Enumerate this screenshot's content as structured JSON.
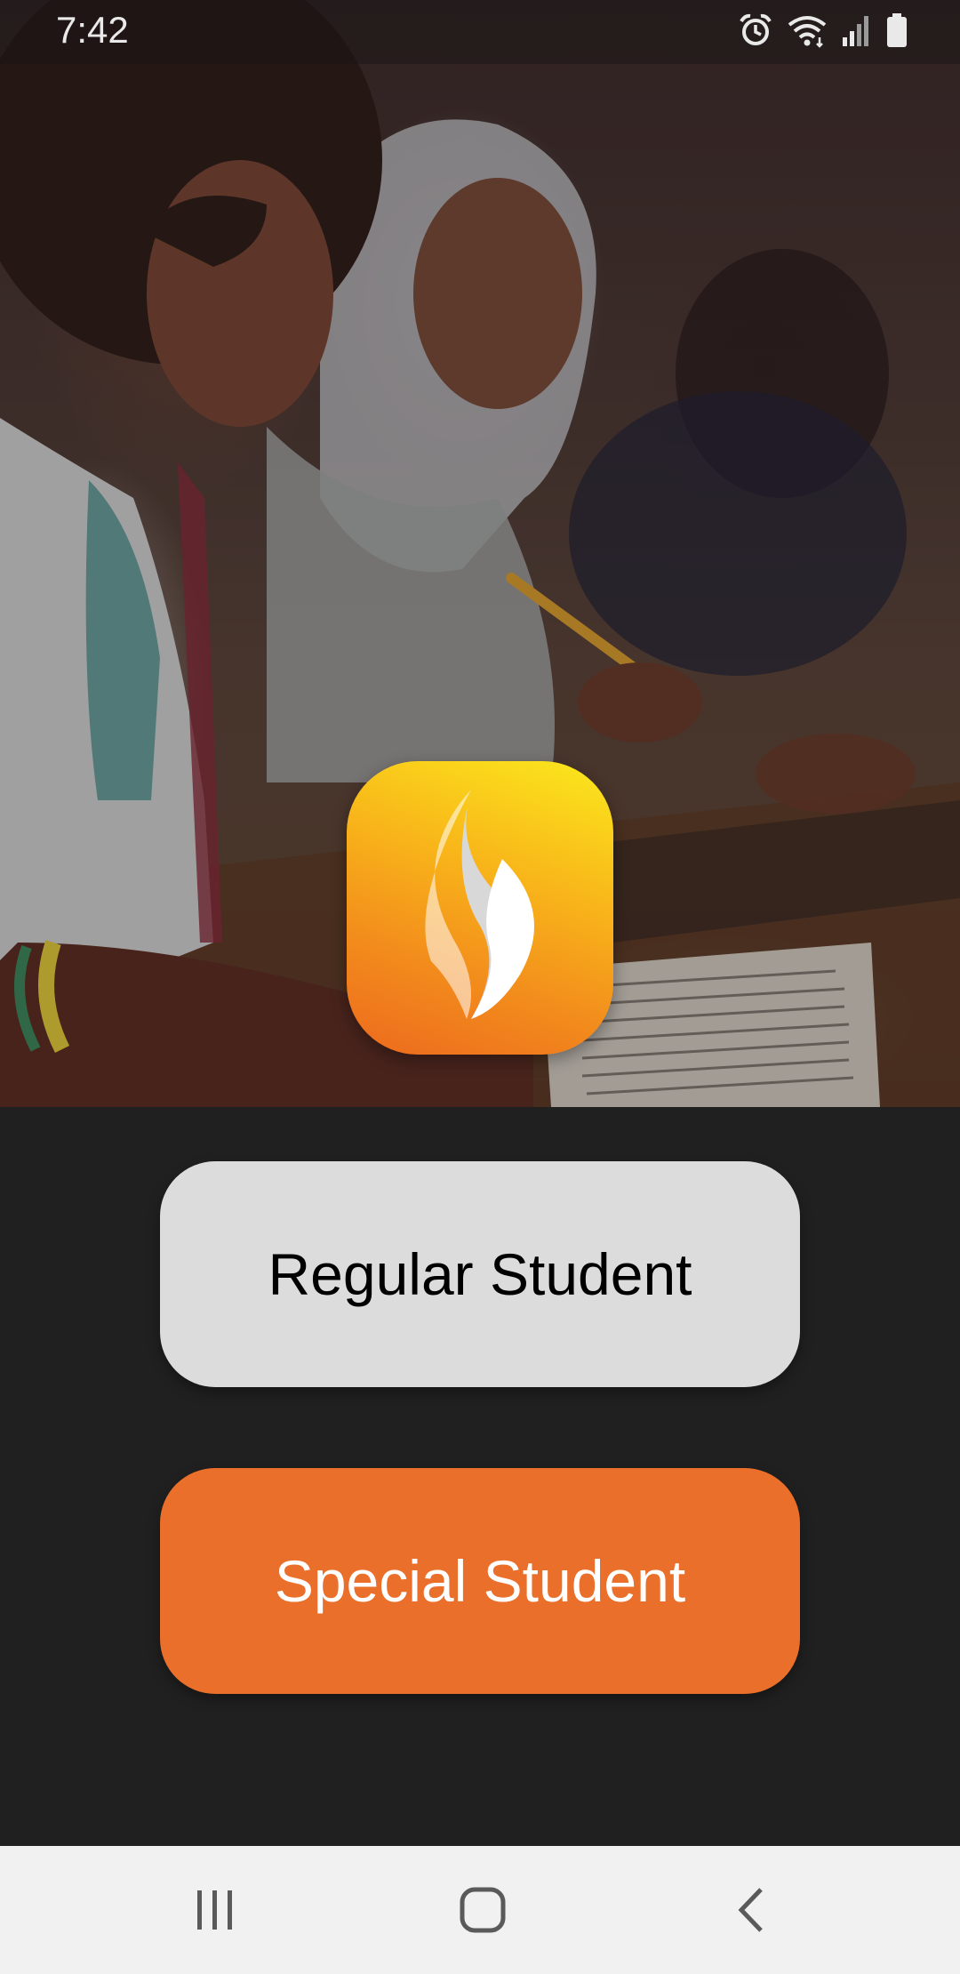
{
  "status_bar": {
    "time": "7:42",
    "icons": [
      "alarm-icon",
      "wifi-icon",
      "signal-icon",
      "battery-icon"
    ]
  },
  "hero": {
    "image": "students-writing-photo"
  },
  "logo": {
    "icon": "flame-icon",
    "colors": [
      "#fbe91c",
      "#f28b1c",
      "#ed6a1e"
    ]
  },
  "buttons": {
    "regular_label": "Regular Student",
    "special_label": "Special Student"
  },
  "nav_bar": {
    "recents_icon": "recents-icon",
    "home_icon": "home-icon",
    "back_icon": "back-icon"
  },
  "colors": {
    "background": "#202020",
    "regular_button": "#dcdcdc",
    "special_button": "#ea6f2a",
    "nav_bar": "#f1f1f1"
  }
}
